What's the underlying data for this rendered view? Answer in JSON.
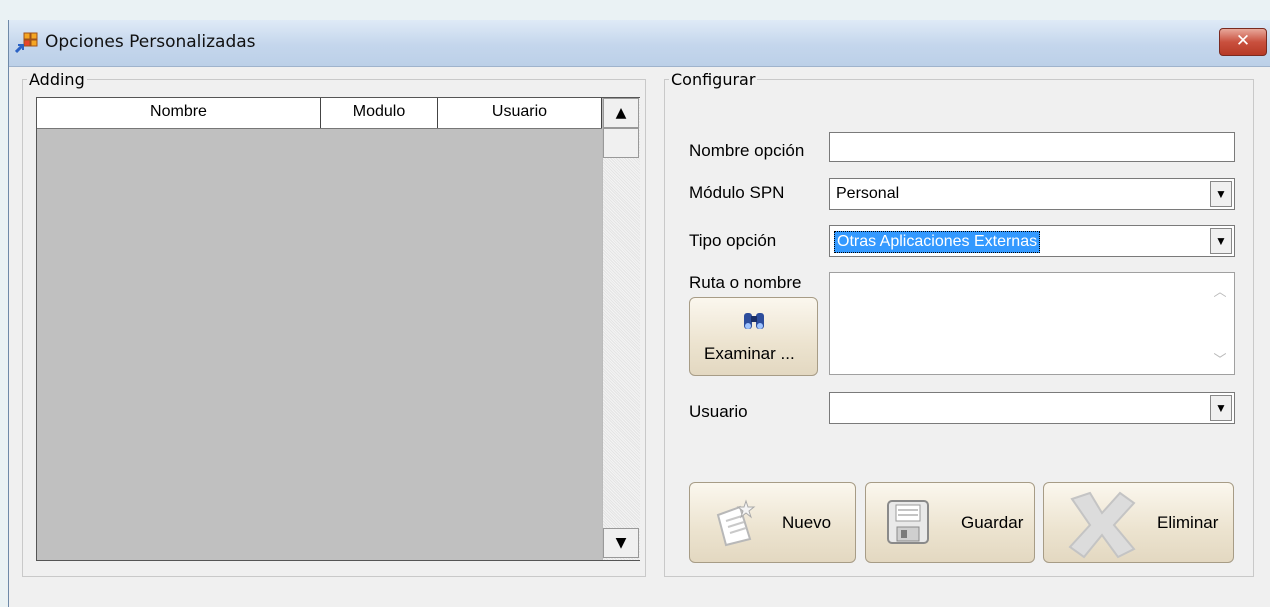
{
  "window": {
    "title": "Opciones Personalizadas",
    "close_symbol": "✕",
    "icon": "app-grid-icon"
  },
  "adding": {
    "legend": "Adding",
    "columns": [
      "Nombre",
      "Modulo",
      "Usuario"
    ],
    "scroll_up": "▲",
    "scroll_down": "▼"
  },
  "config": {
    "legend": "Configurar",
    "nombre_label": "Nombre opción",
    "nombre_value": "",
    "modulo_label": "Módulo SPN",
    "modulo_value": "Personal",
    "tipo_label": "Tipo opción",
    "tipo_value": "Otras Aplicaciones Externas",
    "ruta_label": "Ruta o nombre",
    "ruta_value": "",
    "examinar_label": "Examinar ...",
    "usuario_label": "Usuario",
    "usuario_value": "",
    "dropdown_arrow": "▼",
    "ta_up": "︿",
    "ta_down": "﹀"
  },
  "buttons": {
    "nuevo": "Nuevo",
    "guardar": "Guardar",
    "eliminar": "Eliminar"
  },
  "colors": {
    "selection": "#3399ff",
    "grid_background": "#c0c0c0",
    "button_face": "#ece3cf"
  }
}
